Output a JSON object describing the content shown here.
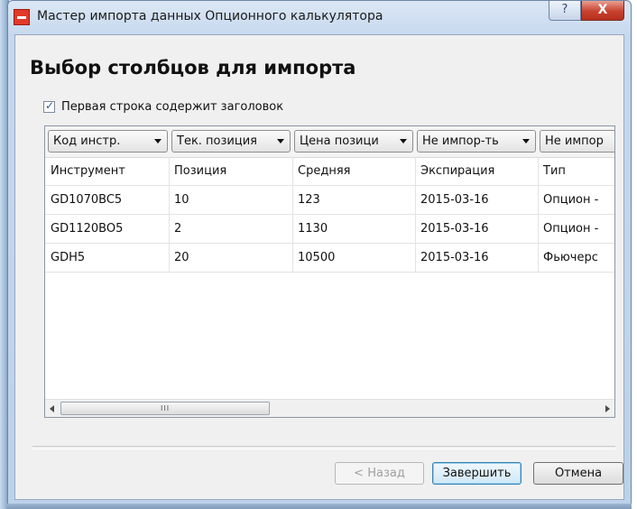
{
  "window": {
    "title": "Мастер импорта данных Опционного калькулятора",
    "help_glyph": "?",
    "close_glyph": "X"
  },
  "page": {
    "heading": "Выбор столбцов для импорта",
    "first_row_header_label": "Первая строка содержит заголовок",
    "first_row_header_checked": true
  },
  "table": {
    "column_selectors": [
      {
        "value": "Код инстр."
      },
      {
        "value": "Тек. позиция"
      },
      {
        "value": "Цена позици"
      },
      {
        "value": "Не импор-ть"
      },
      {
        "value": "Не импор"
      }
    ],
    "rows": [
      [
        "Инструмент",
        "Позиция",
        "Средняя",
        "Экспирация",
        "Тип"
      ],
      [
        "GD1070BC5",
        "10",
        "123",
        "2015-03-16",
        "Опцион -"
      ],
      [
        "GD1120BO5",
        "2",
        "1130",
        "2015-03-16",
        "Опцион -"
      ],
      [
        "GDH5",
        "20",
        "10500",
        "2015-03-16",
        "Фьючерс"
      ]
    ],
    "scroll_grip": "III"
  },
  "buttons": {
    "back": "< Назад",
    "finish": "Завершить",
    "cancel": "Отмена"
  },
  "colors": {
    "title_bar": "#c6d8ee",
    "close_button": "#c7412e",
    "default_button_border": "#3c7fb1"
  }
}
